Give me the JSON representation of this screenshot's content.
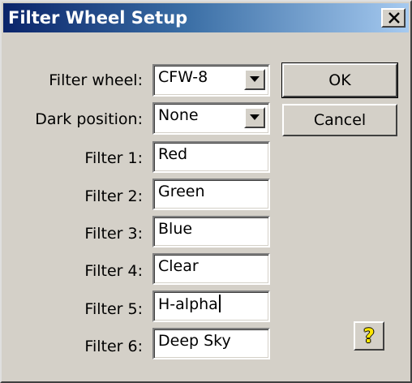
{
  "window": {
    "title": "Filter Wheel Setup"
  },
  "labels": {
    "filter_wheel": "Filter wheel:",
    "dark_position": "Dark position:"
  },
  "filter_wheel": {
    "selected": "CFW-8"
  },
  "dark_position": {
    "selected": "None"
  },
  "filters": [
    {
      "label": "Filter 1:",
      "value": "Red"
    },
    {
      "label": "Filter 2:",
      "value": "Green"
    },
    {
      "label": "Filter 3:",
      "value": "Blue"
    },
    {
      "label": "Filter 4:",
      "value": "Clear"
    },
    {
      "label": "Filter 5:",
      "value": "H-alpha"
    },
    {
      "label": "Filter 6:",
      "value": "Deep Sky"
    }
  ],
  "buttons": {
    "ok": "OK",
    "cancel": "Cancel",
    "help": "?"
  },
  "colors": {
    "dialog_bg": "#d4d0c8",
    "title_start": "#0a246a",
    "title_end": "#a6caf0",
    "help_glyph": "#ffe600"
  },
  "icons": {
    "close": "close-icon",
    "dropdown": "chevron-down-icon",
    "help": "help-icon"
  }
}
